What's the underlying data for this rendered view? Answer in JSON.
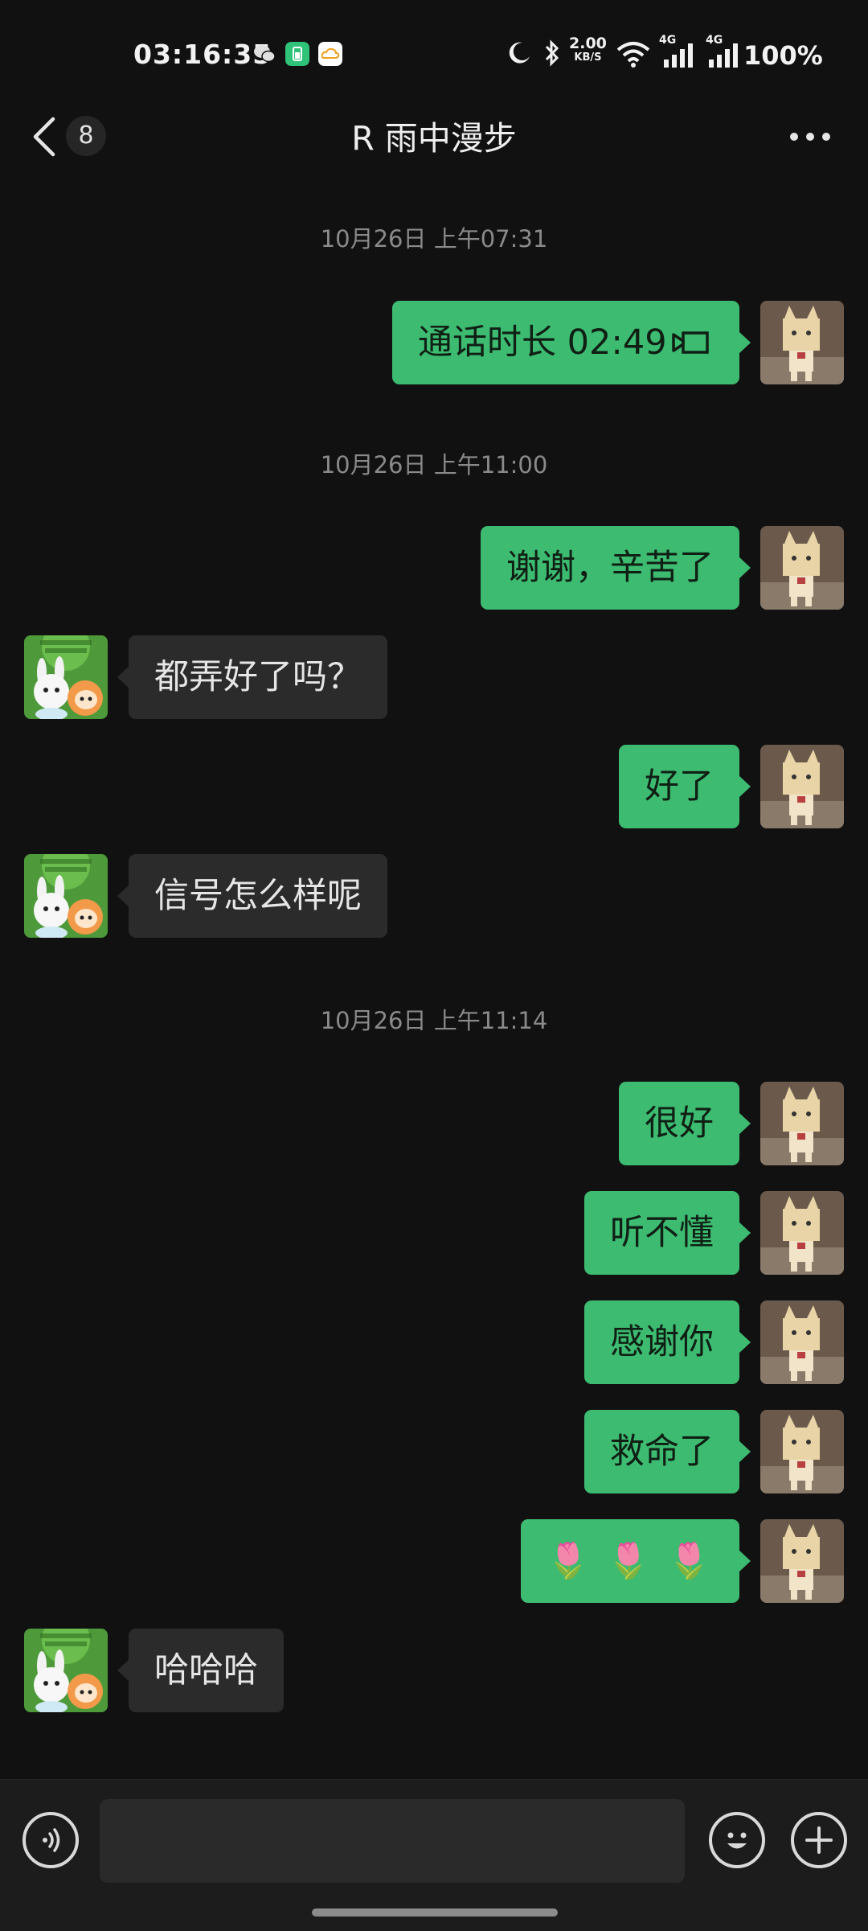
{
  "status_bar": {
    "time": "03:16:35",
    "speed_value": "2.00",
    "speed_unit": "KB/S",
    "network_1": "4G",
    "network_2": "4G",
    "battery": "100%",
    "icons": [
      "wechat-icon",
      "battery-app-icon",
      "cloud-app-icon",
      "moon-icon",
      "bluetooth-icon",
      "wifi-icon",
      "signal-icon",
      "signal-icon"
    ]
  },
  "header": {
    "back_icon": "chevron-left-icon",
    "unread_count": "8",
    "title": "R 雨中漫步",
    "more_icon": "more-dots-icon"
  },
  "chat": {
    "timestamps": [
      "10月26日 上午07:31",
      "10月26日 上午11:00",
      "10月26日 上午11:14"
    ],
    "messages": [
      {
        "sender": "me",
        "text": "通话时长 02:49",
        "icon": "video-call-icon"
      },
      {
        "sender": "me",
        "text": "谢谢，辛苦了"
      },
      {
        "sender": "other",
        "text": "都弄好了吗？"
      },
      {
        "sender": "me",
        "text": "好了"
      },
      {
        "sender": "other",
        "text": "信号怎么样呢"
      },
      {
        "sender": "me",
        "text": "很好"
      },
      {
        "sender": "me",
        "text": "听不懂"
      },
      {
        "sender": "me",
        "text": "感谢你"
      },
      {
        "sender": "me",
        "text": "救命了"
      },
      {
        "sender": "me",
        "text": "🌷 🌷 🌷"
      },
      {
        "sender": "other",
        "text": "哈哈哈"
      }
    ]
  },
  "composer": {
    "voice_icon": "voice-icon",
    "emoji_icon": "emoji-icon",
    "plus_icon": "plus-icon"
  },
  "colors": {
    "background": "#111111",
    "my_bubble": "#3dbb71",
    "other_bubble": "#2b2b2b"
  }
}
